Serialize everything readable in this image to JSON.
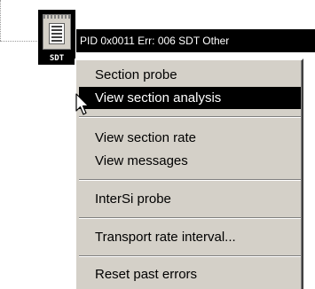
{
  "node": {
    "icon": "sdt-table-icon",
    "tag": "SDT",
    "label": "PID 0x0011  Err: 006  SDT Other"
  },
  "menu": {
    "items": [
      {
        "label": "Section probe"
      },
      {
        "label": "View section analysis",
        "highlighted": true
      },
      {
        "label": "View section rate"
      },
      {
        "label": "View messages"
      },
      {
        "label": "InterSi probe"
      },
      {
        "label": "Transport rate interval..."
      },
      {
        "label": "Reset past errors"
      }
    ]
  },
  "colors": {
    "menu_bg": "#d4d0c8",
    "highlight_bg": "#000000",
    "highlight_fg": "#ffffff"
  }
}
